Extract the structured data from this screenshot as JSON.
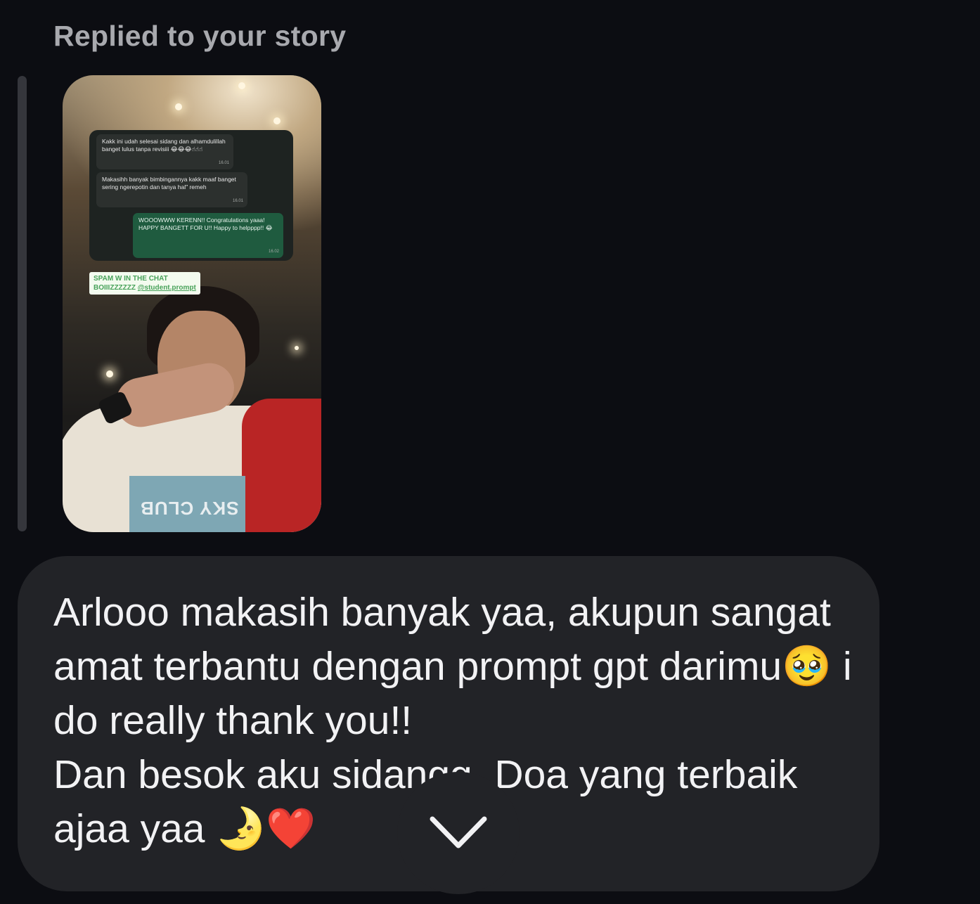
{
  "reply": {
    "header": "Replied to your story"
  },
  "story": {
    "chat": {
      "msg1": "Kakk ini udah selesai sidang dan alhamdulillah banget lulus tanpa revisiii 😂😂😂☝☝☝",
      "msg1_time": "16.01",
      "msg2": "Makasihh banyak bimbingannya kakk maaf banget sering ngerepotin dan tanya hal\" remeh",
      "msg2_time": "16.01",
      "msg3": "WOOOWWW KERENN!! Congratulations yaaa! HAPPY BANGETT FOR U!! Happy to helpppp!! 😂",
      "msg3_time": "16.02"
    },
    "sticker_line1": "SPAM W IN THE CHAT",
    "sticker_line2": "BOIIIZZZZZZ",
    "sticker_handle": "@student.prompt",
    "sweater_text": "SKY CLUB"
  },
  "message": {
    "text": "Arlooo makasih banyak yaa, akupun sangat amat terbantu dengan prompt gpt darimu🥹 i do really thank you!!\nDan besok aku sidangg. Doa yang terbaik ajaa yaa 🌛❤️"
  },
  "icons": {
    "scroll_down": "chevron-down-icon"
  }
}
